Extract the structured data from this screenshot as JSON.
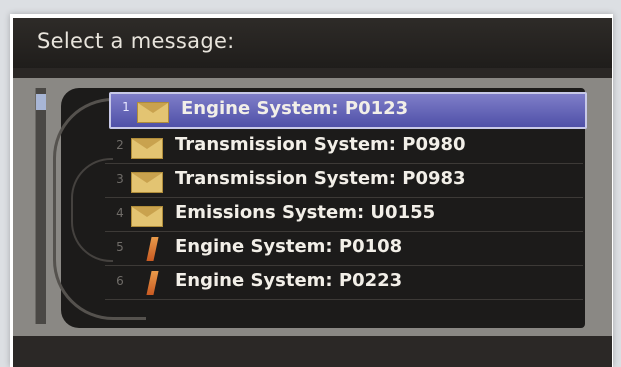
{
  "screen": {
    "title": "Select a message:"
  },
  "messages": [
    {
      "index": "1",
      "label": "Engine System: P0123",
      "icon": "envelope-icon",
      "selected": true
    },
    {
      "index": "2",
      "label": "Transmission System: P0980",
      "icon": "envelope-icon",
      "selected": false
    },
    {
      "index": "3",
      "label": "Transmission System: P0983",
      "icon": "envelope-icon",
      "selected": false
    },
    {
      "index": "4",
      "label": "Emissions System: U0155",
      "icon": "envelope-icon",
      "selected": false
    },
    {
      "index": "5",
      "label": "Engine System: P0108",
      "icon": "bar-icon",
      "selected": false
    },
    {
      "index": "6",
      "label": "Engine System: P0223",
      "icon": "bar-icon",
      "selected": false
    }
  ],
  "colors": {
    "selection": "#5f60b4",
    "envelope": "#e3c472",
    "bar": "#d8773a"
  }
}
